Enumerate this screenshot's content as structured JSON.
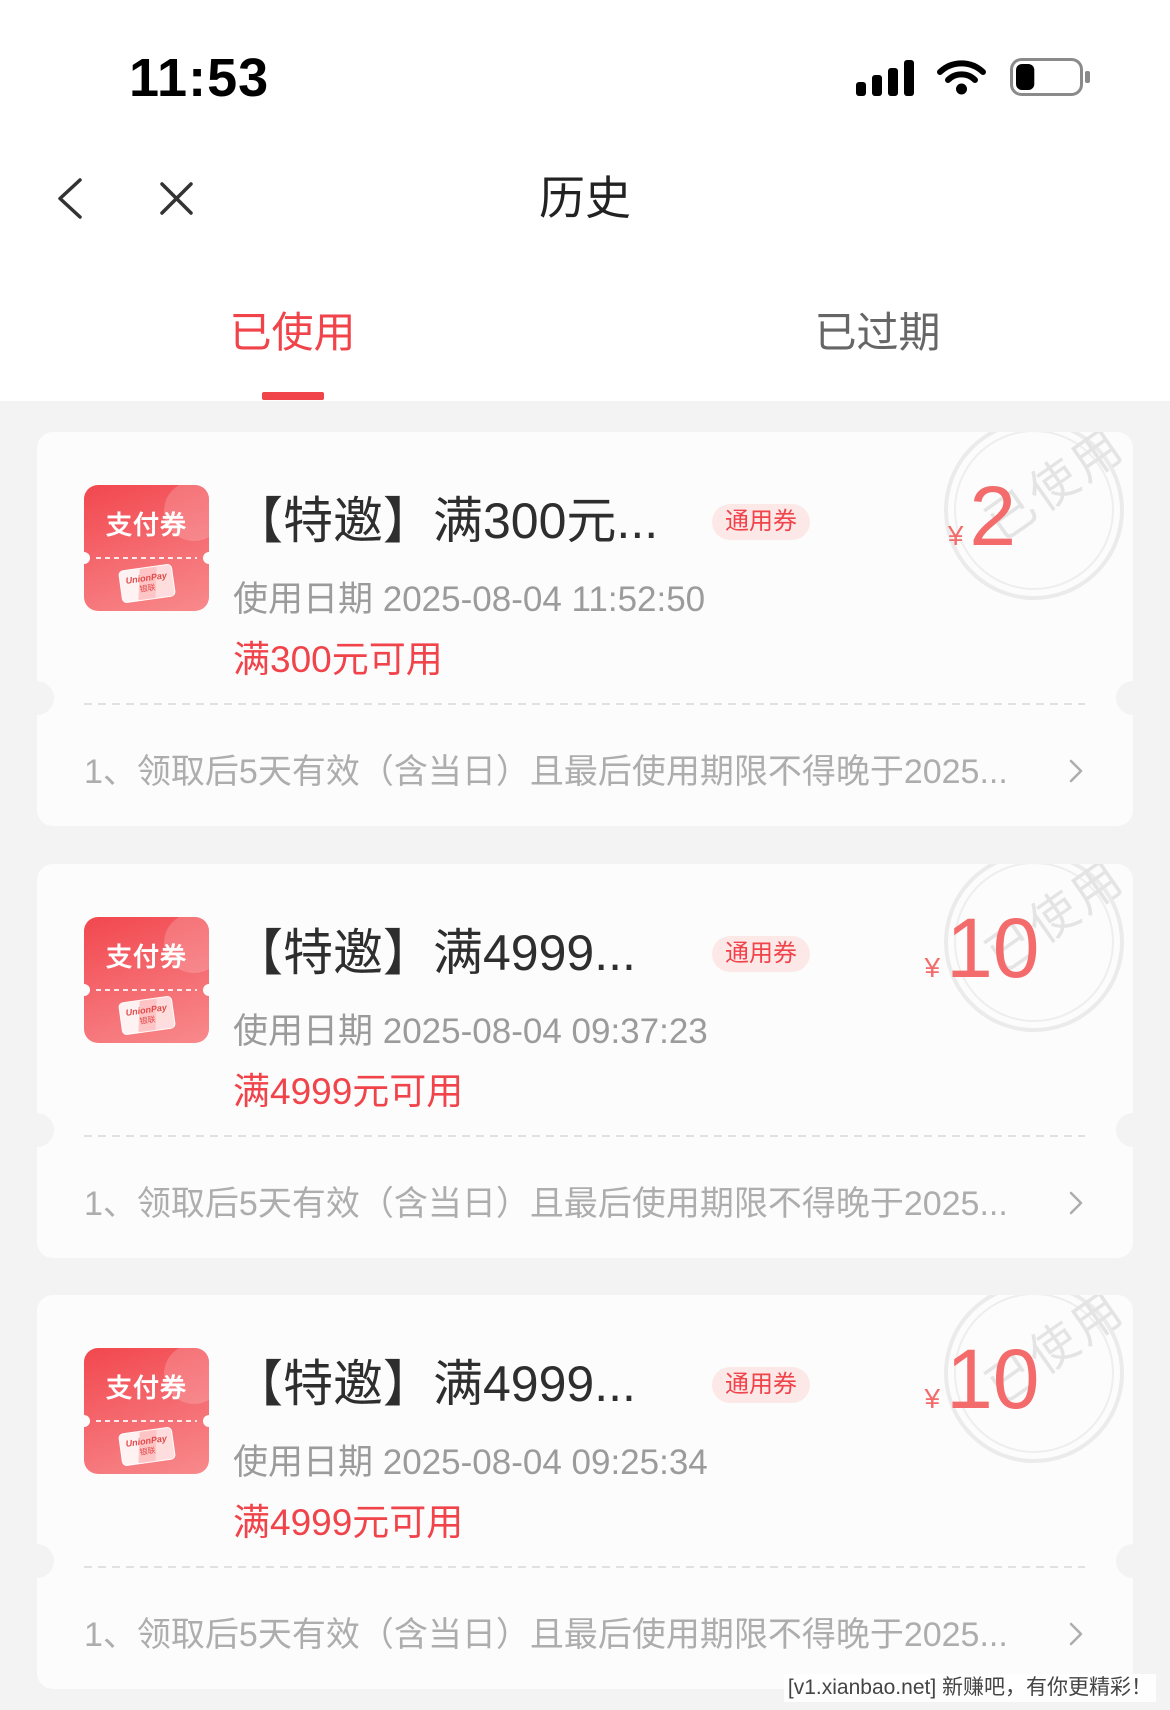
{
  "status_bar": {
    "time": "11:53",
    "battery_level": 0.3
  },
  "icons": {
    "signal": "cellular-signal-icon",
    "wifi": "wifi-icon",
    "battery": "battery-icon",
    "back": "chevron-left-icon",
    "close": "close-icon",
    "rule_more": "chevron-right-icon",
    "stamp": "used-stamp-icon"
  },
  "nav": {
    "title": "历史"
  },
  "tabs": [
    {
      "label": "已使用",
      "active": true
    },
    {
      "label": "已过期",
      "active": false
    }
  ],
  "colors": {
    "accent": "#f0434a",
    "price": "#f36b6b",
    "badge_bg": "#fde8e8"
  },
  "coupons": [
    {
      "icon_label": "支付券",
      "brand_en": "UnionPay",
      "brand_cn": "银联",
      "title": "【特邀】满300元...",
      "badge": "通用券",
      "currency": "¥",
      "amount": "2",
      "date_label": "使用日期",
      "date": "2025-08-04 11:52:50",
      "condition": "满300元可用",
      "rule": "1、领取后5天有效（含当日）且最后使用期限不得晚于2025...",
      "stamp": "已使用"
    },
    {
      "icon_label": "支付券",
      "brand_en": "UnionPay",
      "brand_cn": "银联",
      "title": "【特邀】满4999...",
      "badge": "通用券",
      "currency": "¥",
      "amount": "10",
      "date_label": "使用日期",
      "date": "2025-08-04 09:37:23",
      "condition": "满4999元可用",
      "rule": "1、领取后5天有效（含当日）且最后使用期限不得晚于2025...",
      "stamp": "已使用"
    },
    {
      "icon_label": "支付券",
      "brand_en": "UnionPay",
      "brand_cn": "银联",
      "title": "【特邀】满4999...",
      "badge": "通用券",
      "currency": "¥",
      "amount": "10",
      "date_label": "使用日期",
      "date": "2025-08-04 09:25:34",
      "condition": "满4999元可用",
      "rule": "1、领取后5天有效（含当日）且最后使用期限不得晚于2025...",
      "stamp": "已使用"
    }
  ],
  "watermark": "[v1.xianbao.net] 新赚吧，有你更精彩！"
}
